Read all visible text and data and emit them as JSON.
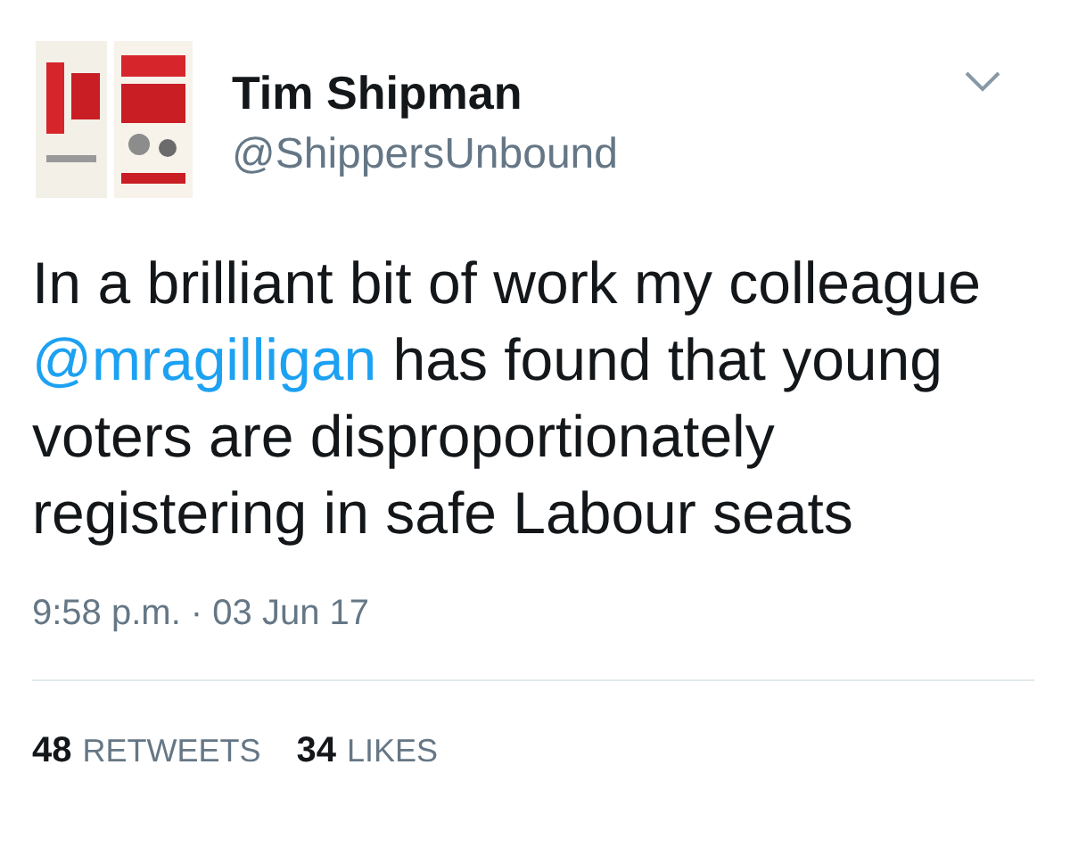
{
  "author": {
    "name": "Tim Shipman",
    "handle": "@ShippersUnbound"
  },
  "tweet": {
    "text_before": "In a brilliant bit of work my colleague ",
    "mention": "@mragilligan",
    "text_after": " has found that young voters are disproportionately registering in safe Labour seats"
  },
  "timestamp": "9:58 p.m. · 03 Jun 17",
  "stats": [
    {
      "count": "48",
      "label": "RETWEETS"
    },
    {
      "count": "34",
      "label": "LIKES"
    }
  ]
}
